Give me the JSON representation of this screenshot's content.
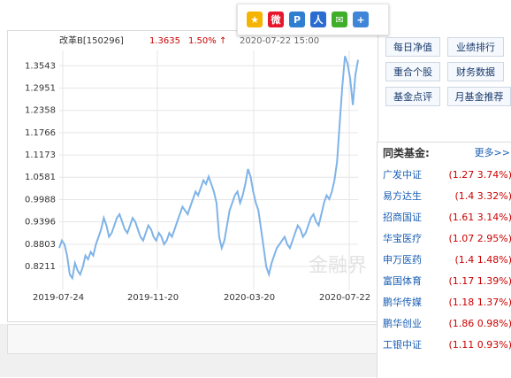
{
  "share": {
    "icons": [
      {
        "name": "qzone-share-icon",
        "color": "#f5b400",
        "glyph": "★"
      },
      {
        "name": "weibo-share-icon",
        "color": "#e6162d",
        "glyph": "微"
      },
      {
        "name": "pengyou-share-icon",
        "color": "#2f7fd0",
        "glyph": "P"
      },
      {
        "name": "renren-share-icon",
        "color": "#2a6ccf",
        "glyph": "人"
      },
      {
        "name": "wechat-share-icon",
        "color": "#3fae29",
        "glyph": "✉"
      },
      {
        "name": "more-share-icon",
        "color": "#3f86d8",
        "glyph": "+"
      }
    ]
  },
  "header": {
    "fund_name": "改革B[150296]",
    "price": "1.3635",
    "change": "1.50% ↑",
    "timestamp": "2020-07-22 15:00"
  },
  "colors": {
    "line": "#7fb3e8",
    "price_red": "#cc0000",
    "link_blue": "#1a5fb4"
  },
  "chart_data": {
    "type": "line",
    "title": "改革B[150296]",
    "xlabel": "",
    "ylabel": "",
    "x_ticks": [
      "2019-07-24",
      "2019-11-20",
      "2020-03-20",
      "2020-07-22"
    ],
    "y_ticks": [
      "1.3543",
      "1.2951",
      "1.2358",
      "1.1766",
      "1.1173",
      "1.0581",
      "0.9988",
      "0.9396",
      "0.8803",
      "0.8211"
    ],
    "ylim": [
      0.76,
      1.395
    ],
    "grid": true,
    "series": [
      {
        "values": [
          0.87,
          0.89,
          0.88,
          0.85,
          0.8,
          0.79,
          0.83,
          0.81,
          0.8,
          0.82,
          0.85,
          0.84,
          0.86,
          0.85,
          0.88,
          0.9,
          0.92,
          0.95,
          0.93,
          0.9,
          0.91,
          0.93,
          0.95,
          0.96,
          0.94,
          0.92,
          0.91,
          0.93,
          0.95,
          0.94,
          0.92,
          0.9,
          0.89,
          0.91,
          0.93,
          0.92,
          0.9,
          0.89,
          0.91,
          0.9,
          0.88,
          0.89,
          0.91,
          0.9,
          0.92,
          0.94,
          0.96,
          0.98,
          0.97,
          0.96,
          0.98,
          1.0,
          1.02,
          1.01,
          1.03,
          1.05,
          1.04,
          1.06,
          1.04,
          1.02,
          0.99,
          0.9,
          0.87,
          0.89,
          0.93,
          0.97,
          0.99,
          1.01,
          1.02,
          0.99,
          1.01,
          1.04,
          1.08,
          1.06,
          1.02,
          0.99,
          0.97,
          0.92,
          0.87,
          0.82,
          0.8,
          0.83,
          0.85,
          0.87,
          0.88,
          0.89,
          0.9,
          0.88,
          0.87,
          0.89,
          0.91,
          0.93,
          0.92,
          0.9,
          0.91,
          0.93,
          0.95,
          0.96,
          0.94,
          0.93,
          0.96,
          0.99,
          1.01,
          1.0,
          1.02,
          1.05,
          1.1,
          1.2,
          1.3,
          1.38,
          1.36,
          1.32,
          1.25,
          1.33,
          1.37
        ]
      }
    ]
  },
  "watermark": "金融界",
  "nav_buttons": [
    "每日净值",
    "业绩排行",
    "重合个股",
    "财务数据",
    "基金点评",
    "月基金推荐"
  ],
  "peers": {
    "title": "同类基金:",
    "more": "更多>>",
    "items": [
      {
        "name": "广发中证",
        "value": "(1.27 3.74%)"
      },
      {
        "name": "易方达生",
        "value": "(1.4 3.32%)"
      },
      {
        "name": "招商国证",
        "value": "(1.61 3.14%)"
      },
      {
        "name": "华宝医疗",
        "value": "(1.07 2.95%)"
      },
      {
        "name": "申万医药",
        "value": "(1.4 1.48%)"
      },
      {
        "name": "富国体育",
        "value": "(1.17 1.39%)"
      },
      {
        "name": "鹏华传媒",
        "value": "(1.18 1.37%)"
      },
      {
        "name": "鹏华创业",
        "value": "(1.86 0.98%)"
      },
      {
        "name": "工银中证",
        "value": "(1.11 0.93%)"
      }
    ]
  }
}
